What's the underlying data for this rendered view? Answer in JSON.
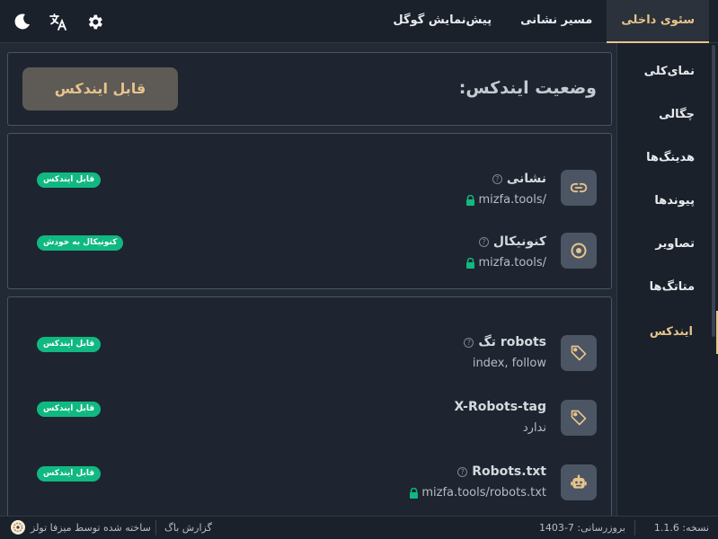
{
  "topbar": {
    "tabs": [
      {
        "label": "سئوی داخلی",
        "active": true
      },
      {
        "label": "مسیر نشانی",
        "active": false
      },
      {
        "label": "پیش‌نمایش گوگل",
        "active": false
      }
    ],
    "icons": [
      "moon-icon",
      "translate-icon",
      "gear-icon"
    ]
  },
  "sidebar": {
    "items": [
      {
        "label": "نمای‌کلی"
      },
      {
        "label": "چگالی"
      },
      {
        "label": "هدینگ‌ها"
      },
      {
        "label": "پیوندها"
      },
      {
        "label": "تصاویر"
      },
      {
        "label": "متاتگ‌ها"
      },
      {
        "label": "ایندکس",
        "active": true
      }
    ]
  },
  "status": {
    "title": "وضعیت ایندکس:",
    "button": "قابل ایندکس"
  },
  "url_rows": [
    {
      "title": "نشانی",
      "help": "?",
      "value": "mizfa.tools/",
      "badge": "قابل ایندکس",
      "icon": "link-icon"
    },
    {
      "title": "کنونیکال",
      "help": "?",
      "value": "mizfa.tools/",
      "badge": "کنونیکال به خودش",
      "icon": "target-icon"
    }
  ],
  "robots_rows": [
    {
      "title": "robots تگ",
      "help": "?",
      "value": "index, follow",
      "badge": "قابل ایندکس",
      "icon": "tag-icon"
    },
    {
      "title": "X-Robots-tag",
      "value": "ندارد",
      "badge": "قابل ایندکس",
      "icon": "tag-icon"
    },
    {
      "title": "Robots.txt",
      "help": "?",
      "value": "mizfa.tools/robots.txt",
      "badge": "قابل ایندکس",
      "icon": "robot-icon"
    }
  ],
  "footer": {
    "version": "نسخه: 1.1.6",
    "updated": "بروزرسانی: 7-1403",
    "bug_report": "گزارش باگ",
    "made_by": "ساخته شده توسط میزفا تولز"
  },
  "colors": {
    "accent": "#e6c48c",
    "badge": "#10b981",
    "background": "#222a35",
    "panel": "#1e2530"
  }
}
